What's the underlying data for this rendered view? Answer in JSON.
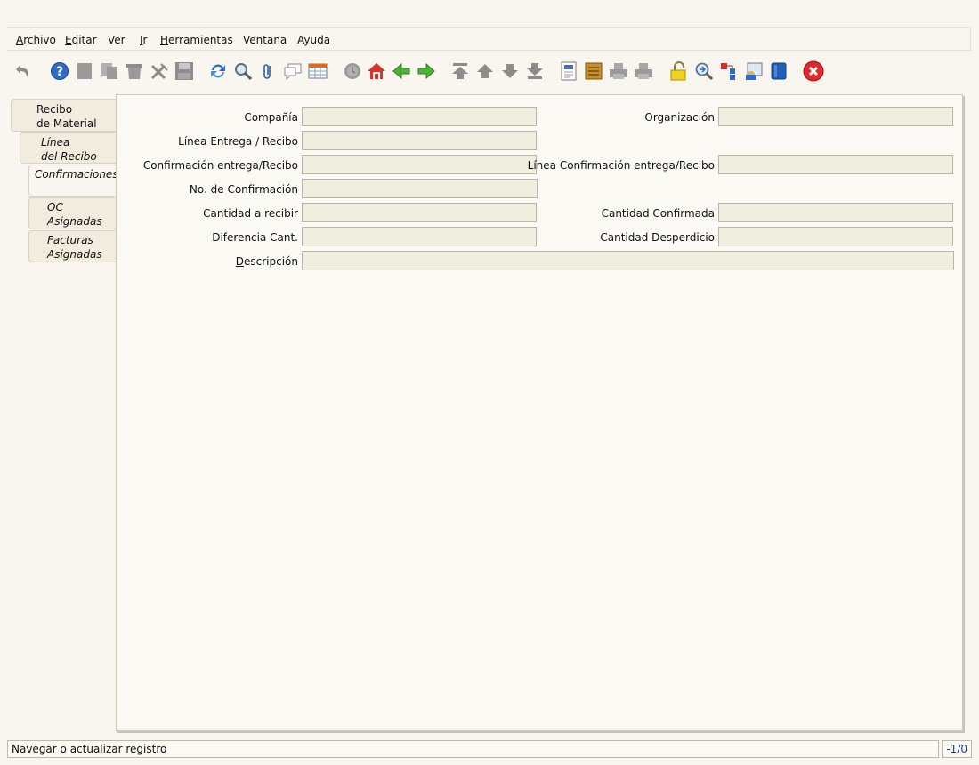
{
  "menu": {
    "archivo": {
      "accel": "A",
      "rest": "rchivo"
    },
    "editar": {
      "accel": "E",
      "rest": "ditar"
    },
    "ver": {
      "accel": "",
      "rest": "Ver"
    },
    "ir": {
      "accel": "I",
      "rest": "r"
    },
    "herramientas": {
      "accel": "H",
      "rest": "erramientas"
    },
    "ventana": {
      "accel": "",
      "rest": "Ventana"
    },
    "ayuda": {
      "accel": "",
      "rest": "Ayuda"
    }
  },
  "toolbar": {
    "icons": [
      "undo-icon",
      "help-icon",
      "new-record-icon",
      "copy-record-icon",
      "delete-icon",
      "delete-selection-icon",
      "save-icon",
      "refresh-icon",
      "find-icon",
      "attachment-icon",
      "chat-icon",
      "grid-toggle-icon",
      "history-icon",
      "home-icon",
      "parent-record-icon",
      "detail-record-icon",
      "first-record-icon",
      "previous-record-icon",
      "next-record-icon",
      "last-record-icon",
      "report-icon",
      "archive-icon",
      "print-preview-icon",
      "print-icon",
      "lock-icon",
      "zoom-across-icon",
      "workflow-icon",
      "request-icon",
      "product-info-icon",
      "exit-icon"
    ]
  },
  "tabs": [
    {
      "line1": "Recibo",
      "line2": "de Material"
    },
    {
      "line1": "Línea",
      "line2": "del Recibo"
    },
    {
      "line1": "Confirmaciones",
      "line2": ""
    },
    {
      "line1": "OC",
      "line2": "Asignadas"
    },
    {
      "line1": "Facturas",
      "line2": "Asignadas"
    }
  ],
  "form": {
    "compania": {
      "label": "Compañía",
      "value": ""
    },
    "organizacion": {
      "label": "Organización",
      "value": ""
    },
    "linea_entrega": {
      "label": "Línea Entrega / Recibo",
      "value": ""
    },
    "confirmacion_entrega": {
      "label": "Confirmación entrega/Recibo",
      "value": ""
    },
    "linea_confirmacion": {
      "label": "Línea Confirmación entrega/Recibo",
      "value": ""
    },
    "no_confirmacion": {
      "label": "No. de Confirmación",
      "value": ""
    },
    "cantidad_recibir": {
      "label": "Cantidad a recibir",
      "value": ""
    },
    "cantidad_confirmada": {
      "label": "Cantidad Confirmada",
      "value": ""
    },
    "diferencia": {
      "label": "Diferencia Cant.",
      "value": ""
    },
    "desperdicio": {
      "label": "Cantidad Desperdicio",
      "value": ""
    },
    "descripcion": {
      "label_accel": "D",
      "label_rest": "escripción",
      "value": ""
    }
  },
  "status": {
    "message": "Navegar o actualizar registro",
    "record_info": "-1/0"
  }
}
